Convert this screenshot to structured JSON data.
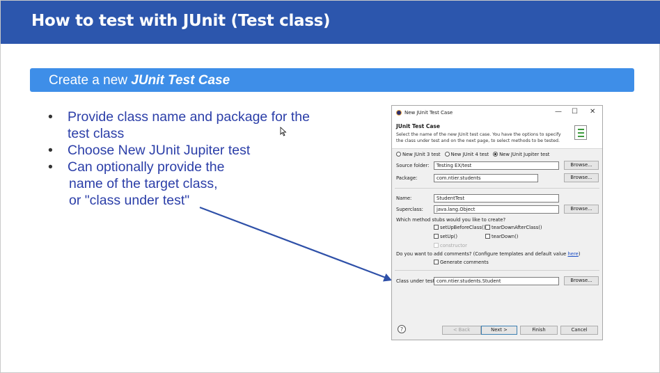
{
  "slide": {
    "title": "How to test with JUnit (Test class)",
    "subtitle_prefix": "Create a new ",
    "subtitle_emph": "JUnit Test Case",
    "bullets": [
      {
        "line1": "Provide class name and package for the",
        "line2": "test class"
      },
      {
        "line1": "Choose New JUnit Jupiter test"
      },
      {
        "line1": "Can optionally provide the",
        "line2": "name of the target class,",
        "line3": "or \"class under test\""
      }
    ],
    "bullet_glyph": "•"
  },
  "dialog": {
    "window_title": "New JUnit Test Case",
    "window_buttons": {
      "minimize": "—",
      "maximize": "☐",
      "close": "✕"
    },
    "header_title": "JUnit Test Case",
    "header_desc": "Select the name of the new JUnit test case. You have the options to specify the class under test and on the next page, to select methods to be tested.",
    "radios": [
      {
        "label": "New JUnit 3 test",
        "selected": false
      },
      {
        "label": "New JUnit 4 test",
        "selected": false
      },
      {
        "label": "New JUnit Jupiter test",
        "selected": true
      }
    ],
    "source_folder_label": "Source folder:",
    "source_folder_value": "Testing EX/test",
    "package_label": "Package:",
    "package_value": "com.ntier.students",
    "name_label": "Name:",
    "name_value": "StudentTest",
    "superclass_label": "Superclass:",
    "superclass_value": "java.lang.Object",
    "browse_label": "Browse...",
    "stubs_question": "Which method stubs would you like to create?",
    "stubs": {
      "setUpBeforeClass": "setUpBeforeClass()",
      "tearDownAfterClass": "tearDownAfterClass()",
      "setUp": "setUp()",
      "tearDown": "tearDown()",
      "constructor": "constructor"
    },
    "comments_question": "Do you want to add comments? (Configure templates and default value ",
    "comments_link": "here",
    "comments_close": ")",
    "generate_comments": "Generate comments",
    "class_under_test_label": "Class under test:",
    "class_under_test_value": "com.ntier.students.Student",
    "help_glyph": "?",
    "back_label": "< Back",
    "next_label": "Next >",
    "finish_label": "Finish",
    "cancel_label": "Cancel"
  },
  "colors": {
    "title_bar": "#2c56ad",
    "subtitle_bar": "#3e8ee8",
    "bullet_text": "#2b3ea8",
    "arrow": "#2e50a8"
  }
}
